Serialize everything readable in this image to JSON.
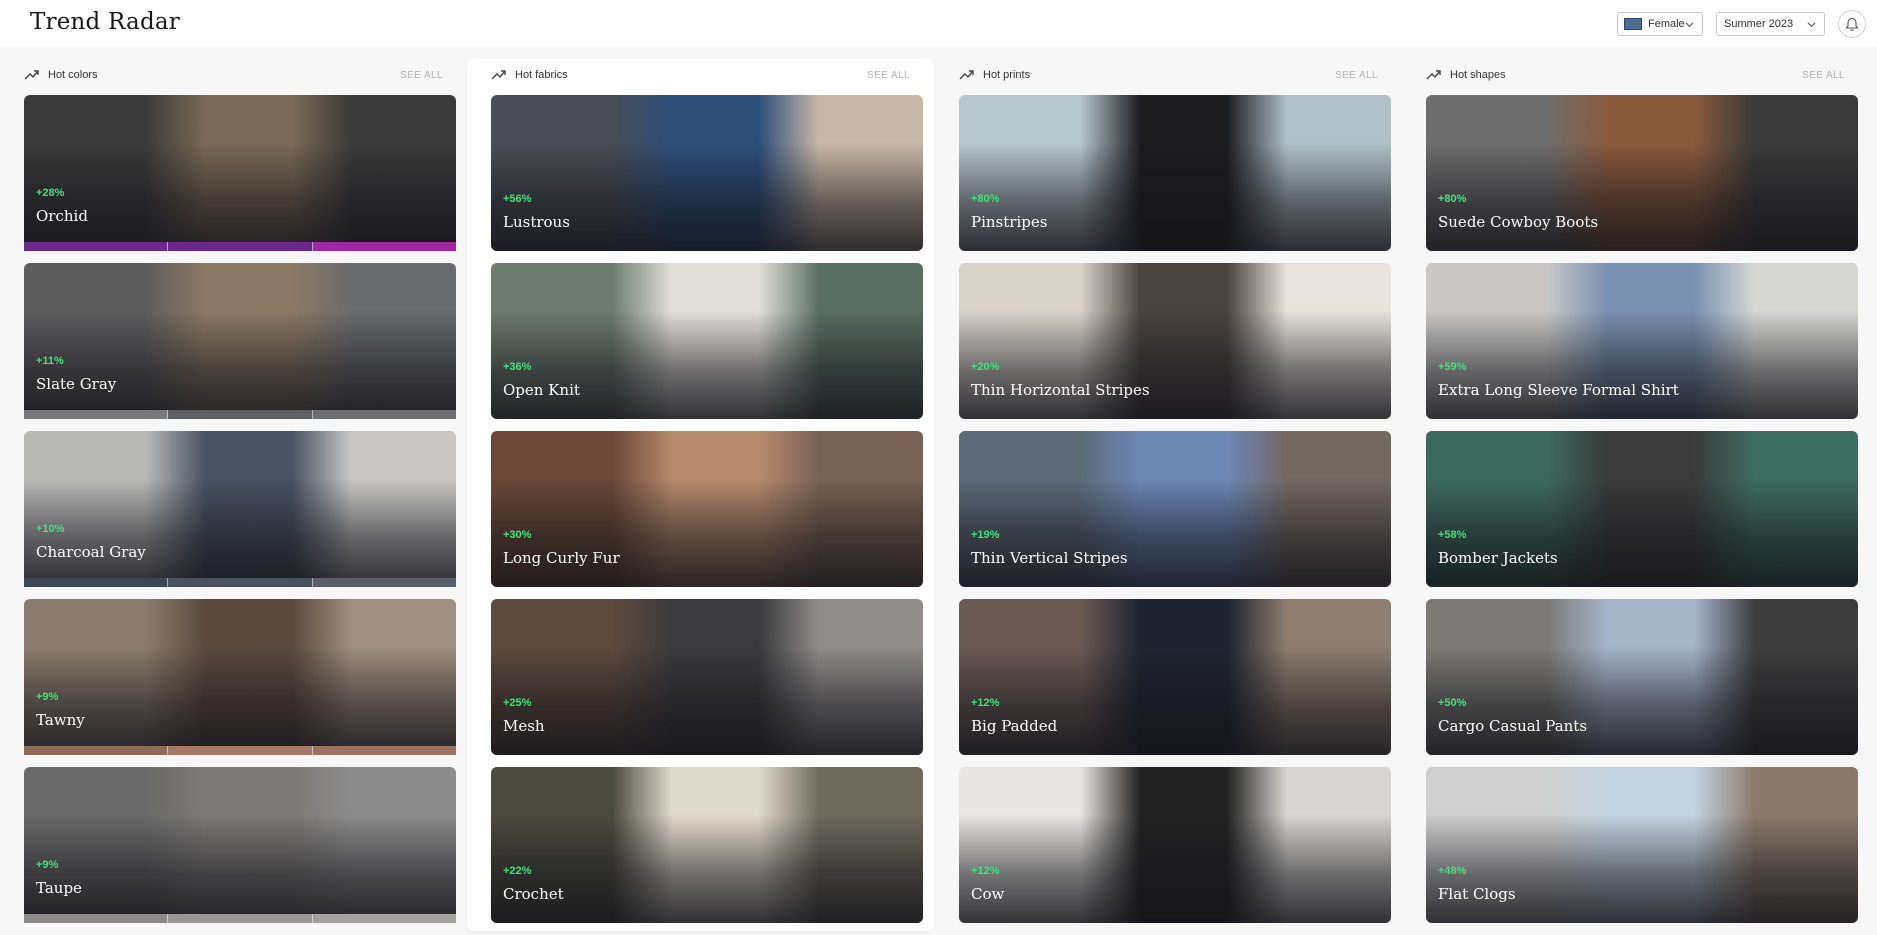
{
  "app": {
    "title": "Trend Radar"
  },
  "filters": {
    "gender": {
      "value": "Female",
      "swatch_color": "#4d6d94"
    },
    "season": {
      "value": "Summer 2023"
    }
  },
  "icons": {
    "trend": "trending-up-icon",
    "chevron": "chevron-down-icon",
    "bell": "bell-icon"
  },
  "columns": [
    {
      "title": "Hot colors",
      "see_all": "SEE ALL",
      "items": [
        {
          "pct": "+28%",
          "name": "Orchid",
          "strip": [
            "#6a2a8c",
            "#6a2a8c",
            "#a227a0"
          ],
          "bg": [
            "#3b3a3a",
            "#7a6a58",
            "#3a3a3a"
          ]
        },
        {
          "pct": "+11%",
          "name": "Slate Gray",
          "strip": [
            "#78797b",
            "#5d5f62",
            "#6d6e70"
          ],
          "bg": [
            "#5e5d5e",
            "#8b7a66",
            "#6a6b6e"
          ]
        },
        {
          "pct": "+10%",
          "name": "Charcoal Gray",
          "strip": [
            "#3d4654",
            "#4a5260",
            "#5a5e66"
          ],
          "bg": [
            "#b9b9b8",
            "#4a5261",
            "#c9c8c6"
          ]
        },
        {
          "pct": "+9%",
          "name": "Tawny",
          "strip": [
            "#8e6a57",
            "#a07a64",
            "#9a7460"
          ],
          "bg": [
            "#8a7d6e",
            "#5a4a40",
            "#9e8f80"
          ]
        },
        {
          "pct": "+9%",
          "name": "Taupe",
          "strip": [
            "#8b8a88",
            "#9a9894",
            "#a3a19e"
          ],
          "bg": [
            "#6a6a6a",
            "#7d7a77",
            "#8c8c8c"
          ]
        }
      ]
    },
    {
      "title": "Hot fabrics",
      "see_all": "SEE ALL",
      "items": [
        {
          "pct": "+56%",
          "name": "Lustrous",
          "bg": [
            "#4a4d55",
            "#2e4f7a",
            "#c8b8a8"
          ]
        },
        {
          "pct": "+36%",
          "name": "Open Knit",
          "bg": [
            "#6d7a70",
            "#e2dfda",
            "#5a6d62"
          ]
        },
        {
          "pct": "+30%",
          "name": "Long Curly Fur",
          "bg": [
            "#6b4838",
            "#b58a6e",
            "#7a6256"
          ]
        },
        {
          "pct": "+25%",
          "name": "Mesh",
          "bg": [
            "#5d4a40",
            "#3b3b3d",
            "#8f8c8a"
          ]
        },
        {
          "pct": "+22%",
          "name": "Crochet",
          "bg": [
            "#4b4a40",
            "#e0d9cd",
            "#6e6a5e"
          ]
        }
      ]
    },
    {
      "title": "Hot prints",
      "see_all": "SEE ALL",
      "items": [
        {
          "pct": "+80%",
          "name": "Pinstripes",
          "bg": [
            "#b9c7cf",
            "#1d1d20",
            "#b2c1c9"
          ]
        },
        {
          "pct": "+20%",
          "name": "Thin Horizontal Stripes",
          "bg": [
            "#d9d3cc",
            "#4a4440",
            "#e8e3dd"
          ]
        },
        {
          "pct": "+19%",
          "name": "Thin Vertical Stripes",
          "bg": [
            "#5e6a78",
            "#6d87b5",
            "#736862"
          ]
        },
        {
          "pct": "+12%",
          "name": "Big Padded",
          "bg": [
            "#6a5a55",
            "#1f2430",
            "#8d7e70"
          ]
        },
        {
          "pct": "+12%",
          "name": "Cow",
          "bg": [
            "#e8e6e2",
            "#222222",
            "#d8d6d2"
          ]
        }
      ]
    },
    {
      "title": "Hot shapes",
      "see_all": "SEE ALL",
      "items": [
        {
          "pct": "+80%",
          "name": "Suede Cowboy Boots",
          "bg": [
            "#6e6e6e",
            "#8a5a3e",
            "#3a3a3a"
          ]
        },
        {
          "pct": "+59%",
          "name": "Extra Long Sleeve Formal Shirt",
          "bg": [
            "#c9c8c6",
            "#7a90b0",
            "#d6d6d3"
          ]
        },
        {
          "pct": "+58%",
          "name": "Bomber Jackets",
          "bg": [
            "#3e6a5e",
            "#3b3b3b",
            "#3f6d62"
          ]
        },
        {
          "pct": "+50%",
          "name": "Cargo Casual Pants",
          "bg": [
            "#7b7a76",
            "#a7b4c9",
            "#3e3e3e"
          ]
        },
        {
          "pct": "+48%",
          "name": "Flat Clogs",
          "bg": [
            "#cfcfcf",
            "#c5d3e0",
            "#8a7a6d"
          ]
        }
      ]
    }
  ]
}
